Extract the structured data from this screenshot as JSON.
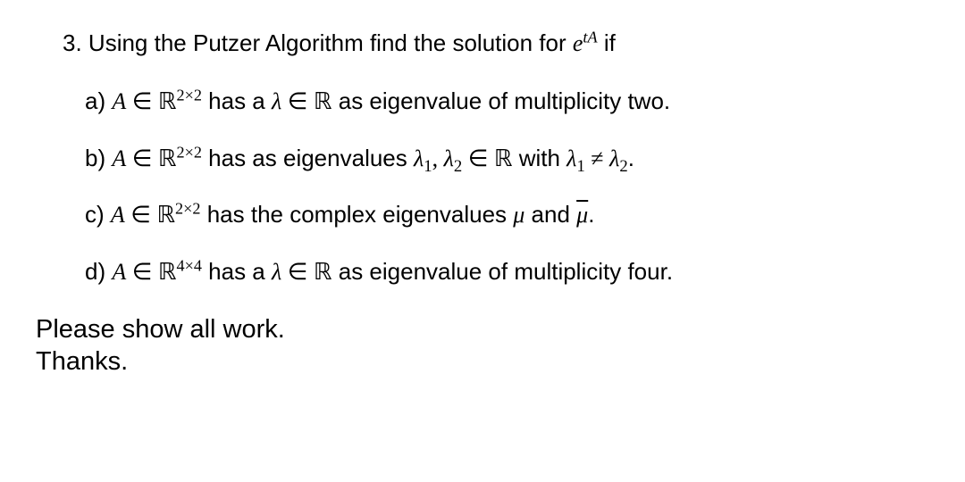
{
  "problem": {
    "number": "3.",
    "intro_before": "Using the Putzer Algorithm find the solution for ",
    "intro_exp_base": "e",
    "intro_exp_sup": "tA",
    "intro_after": " if"
  },
  "parts": {
    "a": {
      "label": "a) ",
      "t1": "A",
      "t2": " ∈ ",
      "t3": "ℝ",
      "t4": "2×2",
      "t5": " has a ",
      "t6": "λ",
      "t7": " ∈ ",
      "t8": "ℝ",
      "t9": " as eigenvalue of multiplicity two."
    },
    "b": {
      "label": "b) ",
      "t1": "A",
      "t2": " ∈ ",
      "t3": "ℝ",
      "t4": "2×2",
      "t5": " has as eigenvalues ",
      "t6": "λ",
      "t7": "1",
      "t8": ", ",
      "t9": "λ",
      "t10": "2",
      "t11": " ∈ ",
      "t12": "ℝ",
      "t13": " with ",
      "t14": "λ",
      "t15": "1",
      "t16": " ≠ ",
      "t17": "λ",
      "t18": "2",
      "t19": "."
    },
    "c": {
      "label": "c) ",
      "t1": "A",
      "t2": " ∈ ",
      "t3": "ℝ",
      "t4": "2×2",
      "t5": " has the complex eigenvalues ",
      "t6": "μ",
      "t7": " and ",
      "t8": "μ",
      "t9": "."
    },
    "d": {
      "label": "d) ",
      "t1": "A",
      "t2": " ∈ ",
      "t3": "ℝ",
      "t4": "4×4",
      "t5": " has a ",
      "t6": "λ",
      "t7": " ∈ ",
      "t8": "ℝ",
      "t9": " as eigenvalue of multiplicity four."
    }
  },
  "closing": {
    "line1": "Please show all work.",
    "line2": "Thanks."
  }
}
